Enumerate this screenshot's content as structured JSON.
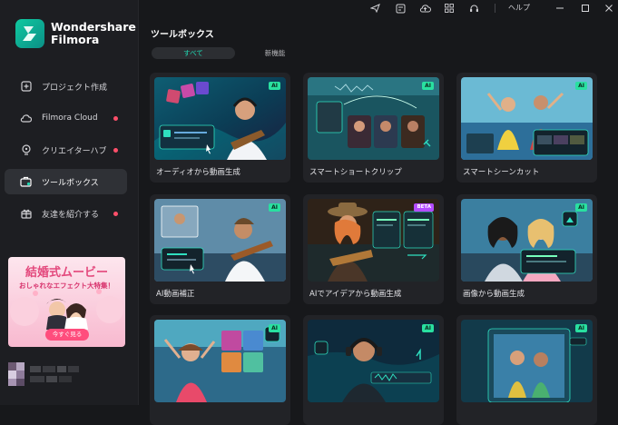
{
  "app": {
    "name_line1": "Wondershare",
    "name_line2": "Filmora"
  },
  "sidebar": {
    "items": [
      {
        "label": "プロジェクト作成",
        "icon": "plus-square-icon",
        "dot": false,
        "active": false
      },
      {
        "label": "Filmora Cloud",
        "icon": "cloud-icon",
        "dot": true,
        "active": false
      },
      {
        "label": "クリエイターハブ",
        "icon": "bulb-icon",
        "dot": true,
        "active": false
      },
      {
        "label": "ツールボックス",
        "icon": "toolbox-icon",
        "dot": false,
        "active": true
      },
      {
        "label": "友達を紹介する",
        "icon": "gift-icon",
        "dot": true,
        "active": false
      }
    ],
    "promo": {
      "title": "結婚式ムービー",
      "subtitle": "おしゃれなエフェクト大特集！",
      "button": "今すぐ見る"
    }
  },
  "topbar": {
    "icons": [
      "send-icon",
      "template-icon",
      "cloud-upload-icon",
      "apps-grid-icon",
      "headset-icon"
    ],
    "help_label": "ヘルプ",
    "window_buttons": [
      "minimize-icon",
      "maximize-icon",
      "close-icon"
    ]
  },
  "main": {
    "title": "ツールボックス",
    "tabs": [
      {
        "label": "すべて",
        "selected": true
      },
      {
        "label": "新機能",
        "selected": false
      }
    ],
    "cards": [
      {
        "label": "オーディオから動画生成",
        "badge": "AI"
      },
      {
        "label": "スマートショートクリップ",
        "badge": "AI"
      },
      {
        "label": "スマートシーンカット",
        "badge": "AI"
      },
      {
        "label": "AI動画補正",
        "badge": "AI"
      },
      {
        "label": "AIでアイデアから動画生成",
        "badge": "BETA"
      },
      {
        "label": "画像から動画生成",
        "badge": "AI"
      },
      {
        "label": "",
        "badge": "AI"
      },
      {
        "label": "",
        "badge": "AI"
      },
      {
        "label": "",
        "badge": "AI"
      }
    ]
  },
  "colors": {
    "accent": "#20d8b2",
    "notify_dot": "#ff4f6a",
    "ai_badge": "#29e0a0",
    "beta_badge": "#b44cff",
    "background": "#17181b"
  }
}
